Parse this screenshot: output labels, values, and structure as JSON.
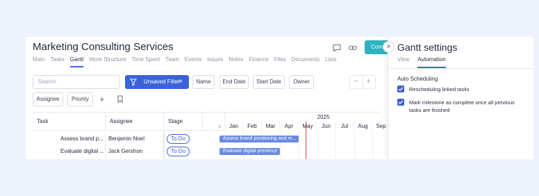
{
  "page": {
    "title": "Marketing Consulting Services",
    "tabs": [
      "Main",
      "Tasks",
      "Gantt",
      "Work Structure",
      "Time Spent",
      "Team",
      "Events",
      "Issues",
      "Notes",
      "Finance",
      "Files",
      "Documents",
      "Lists"
    ],
    "active_tab": "Gantt",
    "header_button_label": "Com"
  },
  "toolbar": {
    "search_placeholder": "Search",
    "filter_label": "Unsaved Filter",
    "filter_clear": "×",
    "name_label": "Name",
    "end_date_label": "End Date",
    "start_date_label": "Start Date",
    "owner_label": "Owner",
    "assignee_label": "Assignee",
    "priority_label": "Priority",
    "add_symbol": "+",
    "zoom_out": "−",
    "zoom_in": "+"
  },
  "table": {
    "columns": [
      "Task",
      "Assignee",
      "Stage"
    ],
    "rows": [
      {
        "task": "Assess brand p...",
        "assignee": "Benjamin Noel",
        "stage": "To Do"
      },
      {
        "task": "Evaluate digital ...",
        "assignee": "Jack Gershon",
        "stage": "To Do"
      }
    ]
  },
  "gantt": {
    "year": "2025",
    "prefix": "c",
    "months": [
      "Jan",
      "Feb",
      "Mar",
      "Apr",
      "May",
      "Jun",
      "Jul",
      "Aug",
      "Sep"
    ],
    "bars": [
      {
        "label": "Assess brand positioning and m..."
      },
      {
        "label": "Evaluate digital presence"
      }
    ]
  },
  "settings": {
    "title": "Gantt settings",
    "tabs": [
      "View",
      "Automation"
    ],
    "active_tab": "Automation",
    "section": "Auto Scheduling",
    "options": [
      {
        "label": "Rescheduling linked tasks",
        "checked": true
      },
      {
        "label": "Mark milestone as complete once all previous tasks are finished",
        "checked": true
      }
    ],
    "close_symbol": "×"
  },
  "colors": {
    "accent": "#3b63d9",
    "bar": "#6a8ae2",
    "teal_button": "#2bb3c0",
    "today_line": "#d33a4a",
    "background": "#eef2fc"
  }
}
